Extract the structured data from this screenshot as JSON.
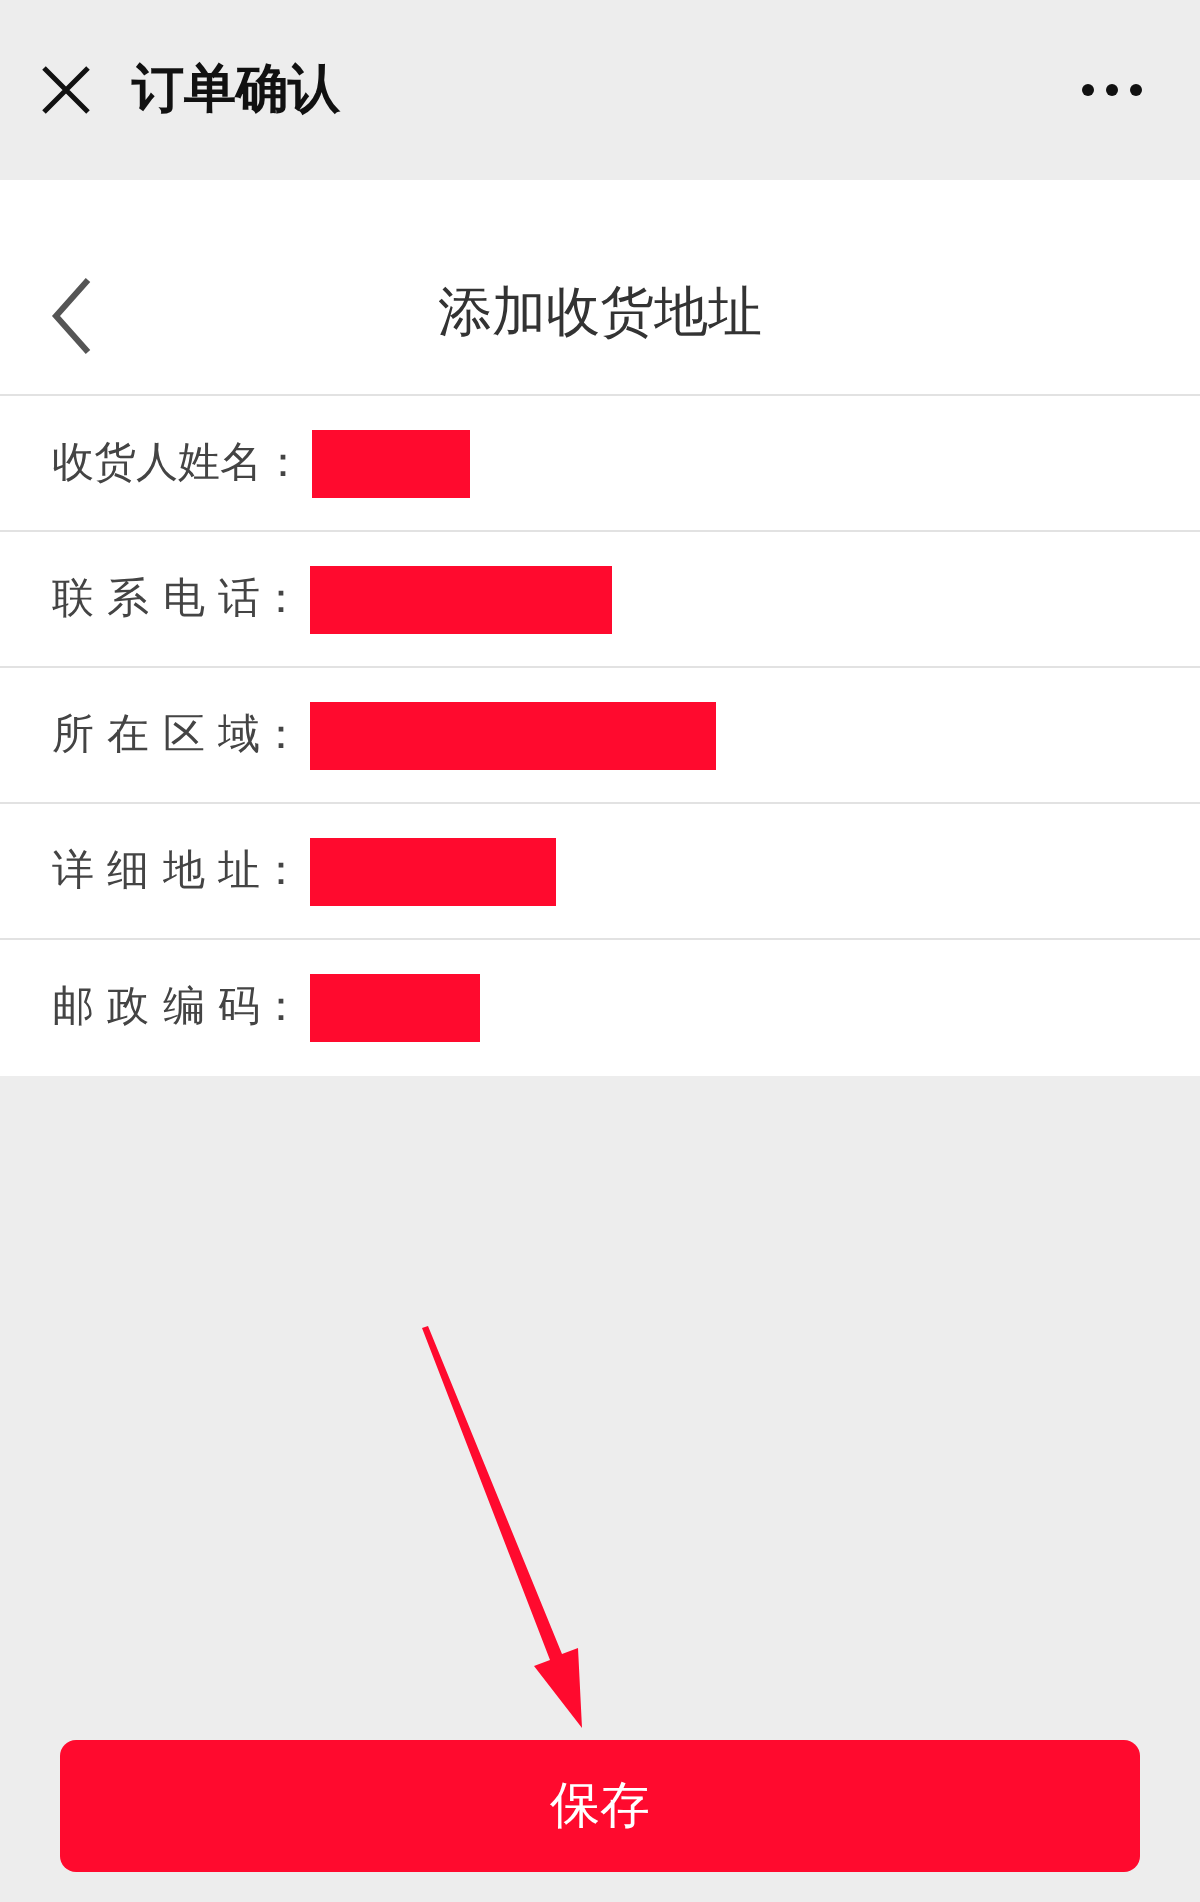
{
  "top_bar": {
    "title": "订单确认"
  },
  "header": {
    "title": "添加收货地址"
  },
  "fields": [
    {
      "label": "收货人姓名："
    },
    {
      "label": "联 系 电 话："
    },
    {
      "label": "所 在 区 域："
    },
    {
      "label": "详 细 地 址："
    },
    {
      "label": "邮 政 编 码："
    }
  ],
  "save_button": {
    "label": "保存"
  }
}
